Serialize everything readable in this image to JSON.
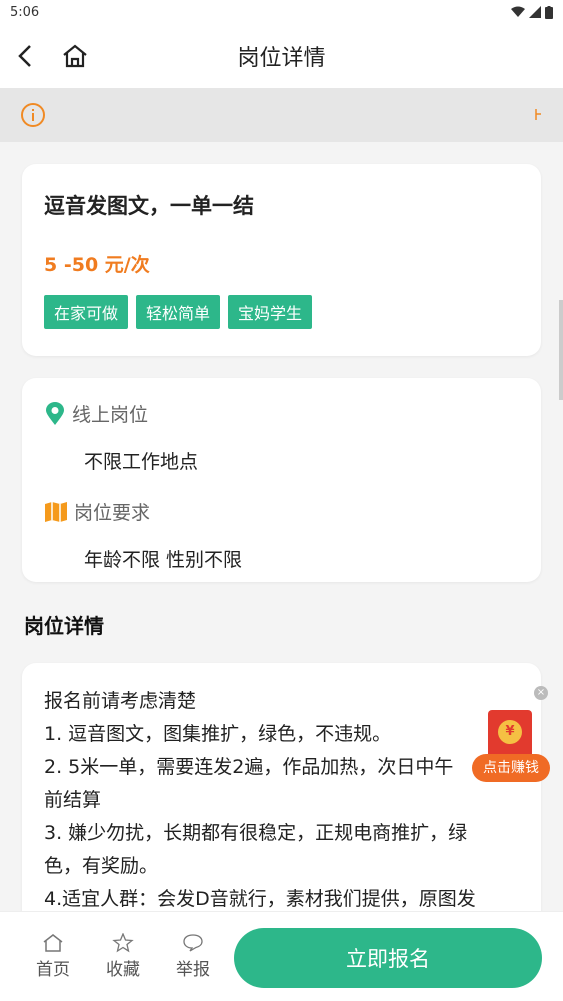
{
  "status": {
    "time": "5:06"
  },
  "header": {
    "title": "岗位详情"
  },
  "job": {
    "title": "逗音发图文，一单一结",
    "salary": "5 -50 元/次",
    "tags": [
      "在家可做",
      "轻松简单",
      "宝妈学生"
    ]
  },
  "location": {
    "type_label": "线上岗位",
    "place": "不限工作地点",
    "req_label": "岗位要求",
    "requirement": "年龄不限 性别不限"
  },
  "details": {
    "section_title": "岗位详情",
    "lines": [
      "报名前请考虑清楚",
      "1. 逗音图文，图集推扩，绿色，不违规。",
      "2. 5米一单，需要连发2遍，作品加热，次日中午",
      "前结算",
      "3. 嫌少勿扰，长期都有很稳定，正规电商推扩，绿",
      "色，有奖励。",
      "4.适宜人群：会发D音就行，素材我们提供，原图发"
    ]
  },
  "redpacket": {
    "label": "点击赚钱",
    "coin": "¥"
  },
  "bottom": {
    "home": "首页",
    "favorite": "收藏",
    "report": "举报",
    "apply": "立即报名"
  },
  "colors": {
    "accent": "#2db78a",
    "salary": "#f07c20"
  }
}
